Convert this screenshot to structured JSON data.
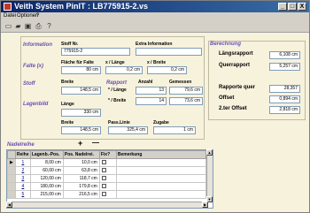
{
  "window": {
    "title": "Veith System PinIT : LB775915-2.vs",
    "minimize": "_",
    "maximize": "□",
    "close": "X"
  },
  "menu": [
    "Datei",
    "Optionen",
    "?"
  ],
  "toolbar": [
    "new-icon",
    "open-icon",
    "save-icon",
    "print-icon",
    "help-icon"
  ],
  "left": {
    "information_label": "Information",
    "stoff_nr_label": "Stoff Nr.",
    "stoff_nr_value": "775915-2",
    "extra_info_label": "Extra Information",
    "extra_info_value": "",
    "falte_label": "Falte (x)",
    "flaeche_label": "Fläche für Falte",
    "flaeche_value": "80 cm",
    "x_lange_label": "x / Länge",
    "x_lange_value": "0,2 cm",
    "x_breite_label": "x / Breite",
    "x_breite_value": "0,2 cm",
    "stoff_label": "Stoff",
    "breite_label": "Breite",
    "breite_value": "148,5 cm",
    "rapport_label": "Rapport",
    "anzahl_label": "Anzahl",
    "gemessen_label": "Gemessen",
    "r_lange_label": "* / Länge",
    "r_lange_anzahl": "13",
    "r_lange_gemessen": "79,6 cm",
    "r_breite_label": "* / Breite",
    "r_breite_anzahl": "14",
    "r_breite_gemessen": "73,6 cm",
    "lagenbild_label": "Lagenbild",
    "lange_label": "Länge",
    "lange_value": "330 cm",
    "lb_breite_label": "Breite",
    "lb_breite_value": "148,5 cm",
    "pass_linie_label": "Pass.Linie",
    "pass_linie_value": "325,4 cm",
    "zugabe_label": "Zugabe",
    "zugabe_value": "1 cm"
  },
  "right": {
    "berechnung_label": "Berechnung",
    "langsrapport_label": "Längsrapport",
    "langsrapport_value": "6,108 cm",
    "querrapport_label": "Querrapport",
    "querrapport_value": "5,257 cm",
    "rapporte_quer_label": "Rapporte quer",
    "rapporte_quer_value": "28,357",
    "offset_label": "Offset",
    "offset_value": "0,894 cm",
    "offset2_label": "2.ter Offset",
    "offset2_value": "2,818 cm"
  },
  "nadelreihe": {
    "label": "Nadelreihe",
    "add": "+",
    "remove": "—",
    "columns": [
      "Reihe",
      "Lagenb.-Pos.",
      "Pos. Nadelrei.",
      "Fix?",
      "Bemerkung"
    ],
    "rows": [
      {
        "reihe": "1",
        "lagenb": "8,00 cm",
        "pos": "10,0 cm",
        "bem": ""
      },
      {
        "reihe": "2",
        "lagenb": "60,00 cm",
        "pos": "63,8 cm",
        "bem": ""
      },
      {
        "reihe": "3",
        "lagenb": "120,00 cm",
        "pos": "118,7 cm",
        "bem": ""
      },
      {
        "reihe": "4",
        "lagenb": "180,00 cm",
        "pos": "179,8 cm",
        "bem": ""
      },
      {
        "reihe": "5",
        "lagenb": "215,00 cm",
        "pos": "216,5 cm",
        "bem": ""
      }
    ]
  }
}
